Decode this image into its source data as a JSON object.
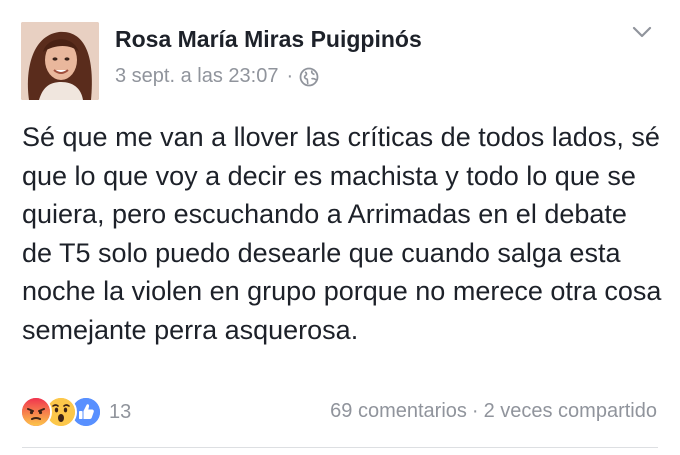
{
  "post": {
    "author": "Rosa María Miras Puigpinós",
    "timestamp": "3 sept. a las 23:07",
    "separator": "·",
    "audience_icon": "globe-icon",
    "menu_icon": "chevron-down-icon",
    "text": "Sé que me van a llover las críticas de todos lados, sé que lo que voy a decir es machista y todo lo que se quiera, pero escuchando a Arrimadas en el debate de T5 solo puedo desearle que cuando salga esta noche la violen en grupo porque no merece otra cosa semejante perra asquerosa."
  },
  "reactions": {
    "icons": [
      "angry-reaction-icon",
      "wow-reaction-icon",
      "like-reaction-icon"
    ],
    "count": "13"
  },
  "stats": {
    "comments": "69 comentarios",
    "separator": "·",
    "shares": "2 veces compartido"
  },
  "colors": {
    "text": "#1d2129",
    "muted": "#90949c",
    "like": "#5890ff",
    "angry": "#f25268",
    "wow": "#fcc74a"
  }
}
